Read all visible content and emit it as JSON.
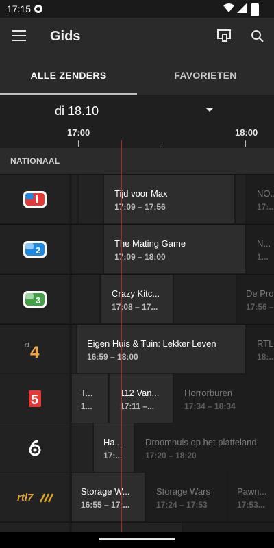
{
  "status": {
    "time": "17:15"
  },
  "appbar": {
    "title": "Gids"
  },
  "tabs": [
    {
      "label": "ALLE ZENDERS"
    },
    {
      "label": "FAVORIETEN"
    }
  ],
  "date": {
    "label": "di 18.10"
  },
  "timeline": {
    "labels": [
      "17:00",
      "18:00"
    ]
  },
  "section": {
    "label": "NATIONAAL"
  },
  "channels": [
    {
      "name": "NPO 1",
      "programs": [
        {
          "title": "Tijd voor Max",
          "time": "17:09 – 17:56"
        },
        {
          "title": "NO...",
          "time": "17:..."
        }
      ]
    },
    {
      "name": "NPO 2",
      "programs": [
        {
          "title": "The Mating Game",
          "time": "17:09 – 18:00"
        },
        {
          "title": "N...",
          "time": "1..."
        }
      ]
    },
    {
      "name": "NPO 3",
      "programs": [
        {
          "title": "Crazy Kitc...",
          "time": "17:08 – 17..."
        },
        {
          "title": "De Pro",
          "time": "17:56 –"
        }
      ]
    },
    {
      "name": "RTL 4",
      "programs": [
        {
          "title": "Eigen Huis & Tuin: Lekker Leven",
          "time": "16:59 – 18:00"
        },
        {
          "title": "RTL",
          "time": "18:..."
        }
      ]
    },
    {
      "name": "RTL 5",
      "programs": [
        {
          "title": "T...",
          "time": "1..."
        },
        {
          "title": "112 Van...",
          "time": "17:11 –..."
        },
        {
          "title": "Horrorburen",
          "time": "17:34 – 18:34"
        }
      ]
    },
    {
      "name": "SBS 6",
      "programs": [
        {
          "title": "Ha...",
          "time": "17:..."
        },
        {
          "title": "Droomhuis op het platteland",
          "time": "17:20 – 18:20"
        }
      ]
    },
    {
      "name": "RTL 7",
      "programs": [
        {
          "title": "Storage W...",
          "time": "16:55 – 17:..."
        },
        {
          "title": "Storage Wars",
          "time": "17:24 – 17:53"
        },
        {
          "title": "Pawn...",
          "time": "17:53..."
        }
      ]
    }
  ],
  "colors": {
    "now_line": "#c42020",
    "rtl7": "#e5a823",
    "rtl5": "#e53935"
  }
}
